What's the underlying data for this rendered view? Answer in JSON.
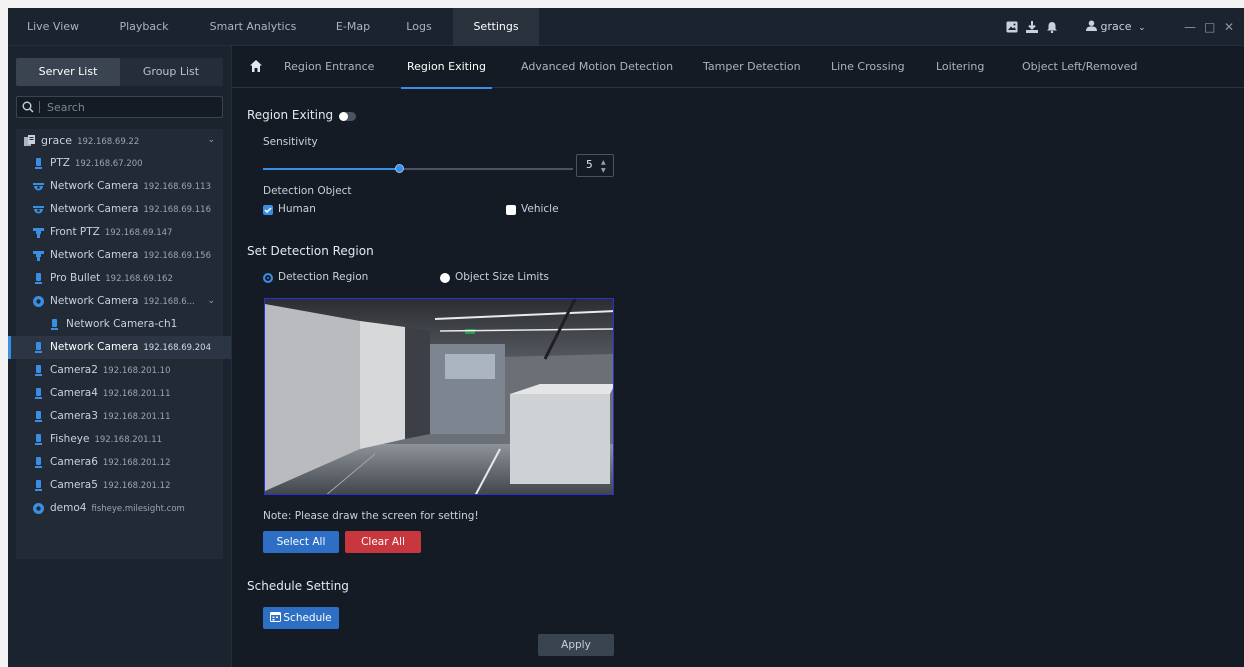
{
  "nav": {
    "tabs": [
      "Live View",
      "Playback",
      "Smart Analytics",
      "E-Map",
      "Logs",
      "Settings"
    ],
    "active": "Settings",
    "user": "grace"
  },
  "sidebar": {
    "tabs": [
      "Server List",
      "Group List"
    ],
    "active_tab": "Server List",
    "search_placeholder": "Search",
    "devices": [
      {
        "name": "grace",
        "ip": "192.168.69.22",
        "icon": "server-icon",
        "expandable": true
      },
      {
        "name": "PTZ",
        "ip": "192.168.67.200",
        "icon": "bullet-camera-icon"
      },
      {
        "name": "Network Camera",
        "ip": "192.168.69.113",
        "icon": "dome-camera-icon"
      },
      {
        "name": "Network Camera",
        "ip": "192.168.69.116",
        "icon": "dome-camera-icon"
      },
      {
        "name": "Front PTZ",
        "ip": "192.168.69.147",
        "icon": "ptz-camera-icon"
      },
      {
        "name": "Network Camera",
        "ip": "192.168.69.156",
        "icon": "ptz-camera-icon"
      },
      {
        "name": "Pro Bullet",
        "ip": "192.168.69.162",
        "icon": "bullet-camera-icon"
      },
      {
        "name": "Network Camera",
        "ip": "192.168.6...",
        "icon": "nvr-icon",
        "expandable": true
      },
      {
        "name": "Network Camera-ch1",
        "ip": "",
        "icon": "bullet-camera-icon",
        "child": true
      },
      {
        "name": "Network Camera",
        "ip": "192.168.69.204",
        "icon": "bullet-camera-icon",
        "selected": true
      },
      {
        "name": "Camera2",
        "ip": "192.168.201.10",
        "icon": "bullet-camera-icon"
      },
      {
        "name": "Camera4",
        "ip": "192.168.201.11",
        "icon": "bullet-camera-icon"
      },
      {
        "name": "Camera3",
        "ip": "192.168.201.11",
        "icon": "bullet-camera-icon"
      },
      {
        "name": "Fisheye",
        "ip": "192.168.201.11",
        "icon": "bullet-camera-icon"
      },
      {
        "name": "Camera6",
        "ip": "192.168.201.12",
        "icon": "bullet-camera-icon"
      },
      {
        "name": "Camera5",
        "ip": "192.168.201.12",
        "icon": "bullet-camera-icon"
      },
      {
        "name": "demo4",
        "ip": "fisheye.milesight.com",
        "icon": "nvr-icon"
      }
    ]
  },
  "subtabs": [
    "Region Entrance",
    "Region Exiting",
    "Advanced Motion Detection",
    "Tamper Detection",
    "Line Crossing",
    "Loitering",
    "Object Left/Removed"
  ],
  "active_subtab": "Region Exiting",
  "form": {
    "region_exiting_label": "Region Exiting",
    "region_exiting_enabled": false,
    "sensitivity_label": "Sensitivity",
    "sensitivity_value": "5",
    "sensitivity_fraction": 0.44,
    "detection_object_label": "Detection Object",
    "human_label": "Human",
    "human_checked": true,
    "vehicle_label": "Vehicle",
    "vehicle_checked": false,
    "set_region_label": "Set Detection Region",
    "detection_region_label": "Detection Region",
    "object_size_label": "Object Size Limits",
    "note": "Note: Please draw the screen for setting!",
    "select_all": "Select All",
    "clear_all": "Clear All",
    "schedule_setting_label": "Schedule Setting",
    "schedule_button": "Schedule",
    "apply": "Apply"
  },
  "colors": {
    "accent": "#3a8ee6",
    "danger": "#c8373e",
    "background": "#141b25"
  }
}
